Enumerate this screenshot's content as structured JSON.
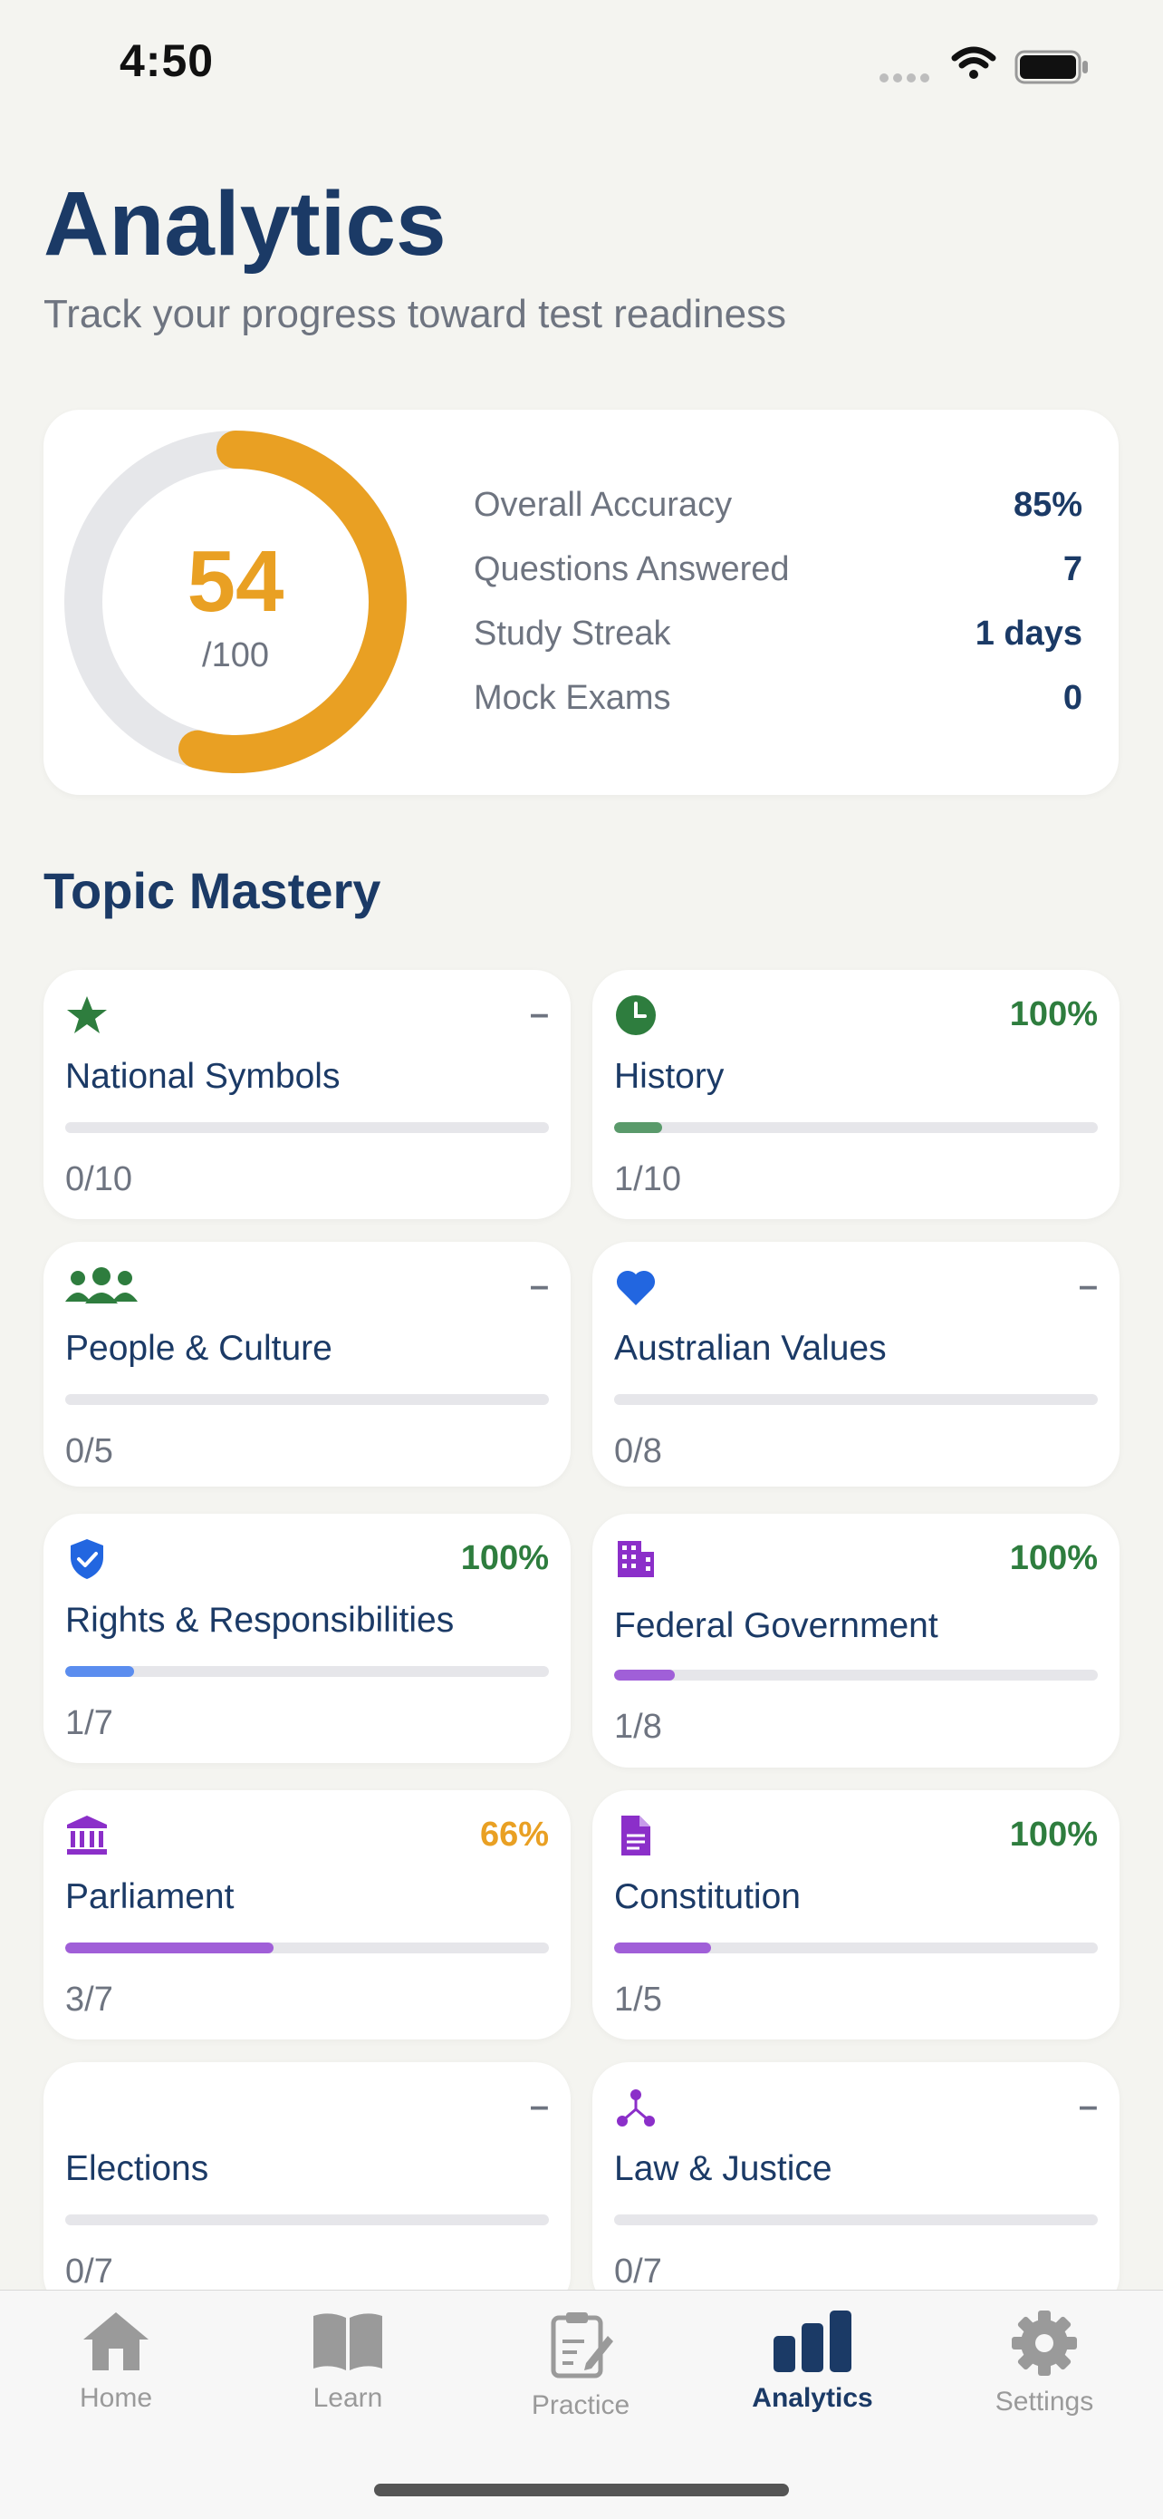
{
  "status": {
    "time": "4:50"
  },
  "header": {
    "title": "Analytics",
    "subtitle": "Track your progress toward test readiness"
  },
  "summary": {
    "score": "54",
    "score_max": "/100",
    "score_fraction": 0.54,
    "ring_color": "#E9A023",
    "stats": [
      {
        "label": "Overall Accuracy",
        "value": "85%"
      },
      {
        "label": "Questions Answered",
        "value": "7"
      },
      {
        "label": "Study Streak",
        "value": "1 days"
      },
      {
        "label": "Mock Exams",
        "value": "0"
      }
    ]
  },
  "topic_mastery": {
    "title": "Topic Mastery",
    "topics": [
      {
        "name": "National Symbols",
        "pct": "–",
        "count": "0/10",
        "progress": 0,
        "icon": "star-icon",
        "icon_color": "#2E7D3E",
        "pct_color": "#6E7480",
        "bar_color": "#E6E6EA"
      },
      {
        "name": "History",
        "pct": "100%",
        "count": "1/10",
        "progress": 0.1,
        "icon": "clock-icon",
        "icon_color": "#2E7D3E",
        "pct_color": "#2E7D3E",
        "bar_color": "#5A9A6B"
      },
      {
        "name": "People & Culture",
        "pct": "–",
        "count": "0/5",
        "progress": 0,
        "icon": "people-icon",
        "icon_color": "#2E7D3E",
        "pct_color": "#6E7480",
        "bar_color": "#E6E6EA"
      },
      {
        "name": "Australian Values",
        "pct": "–",
        "count": "0/8",
        "progress": 0,
        "icon": "heart-icon",
        "icon_color": "#2266E0",
        "pct_color": "#6E7480",
        "bar_color": "#E6E6EA"
      },
      {
        "name": "Rights & Responsibilities",
        "pct": "100%",
        "count": "1/7",
        "progress": 0.143,
        "icon": "shield-check-icon",
        "icon_color": "#2266E0",
        "pct_color": "#2E7D3E",
        "bar_color": "#5B8DEF"
      },
      {
        "name": "Federal Government",
        "pct": "100%",
        "count": "1/8",
        "progress": 0.125,
        "icon": "building-icon",
        "icon_color": "#8B2FC9",
        "pct_color": "#2E7D3E",
        "bar_color": "#A05FD8"
      },
      {
        "name": "Parliament",
        "pct": "66%",
        "count": "3/7",
        "progress": 0.43,
        "icon": "parliament-icon",
        "icon_color": "#8B2FC9",
        "pct_color": "#E9A023",
        "bar_color": "#A05FD8"
      },
      {
        "name": "Constitution",
        "pct": "100%",
        "count": "1/5",
        "progress": 0.2,
        "icon": "document-icon",
        "icon_color": "#8B2FC9",
        "pct_color": "#2E7D3E",
        "bar_color": "#A05FD8"
      },
      {
        "name": "Elections",
        "pct": "–",
        "count": "0/7",
        "progress": 0,
        "icon": "",
        "icon_color": "#8B2FC9",
        "pct_color": "#6E7480",
        "bar_color": "#E6E6EA"
      },
      {
        "name": "Law & Justice",
        "pct": "–",
        "count": "0/7",
        "progress": 0,
        "icon": "network-icon",
        "icon_color": "#8B2FC9",
        "pct_color": "#6E7480",
        "bar_color": "#E6E6EA"
      }
    ]
  },
  "tab_bar": {
    "tabs": [
      {
        "label": "Home",
        "icon": "home-icon",
        "active": false
      },
      {
        "label": "Learn",
        "icon": "book-icon",
        "active": false
      },
      {
        "label": "Practice",
        "icon": "clipboard-edit-icon",
        "active": false
      },
      {
        "label": "Analytics",
        "icon": "bar-chart-icon",
        "active": true
      },
      {
        "label": "Settings",
        "icon": "gear-icon",
        "active": false
      }
    ]
  }
}
